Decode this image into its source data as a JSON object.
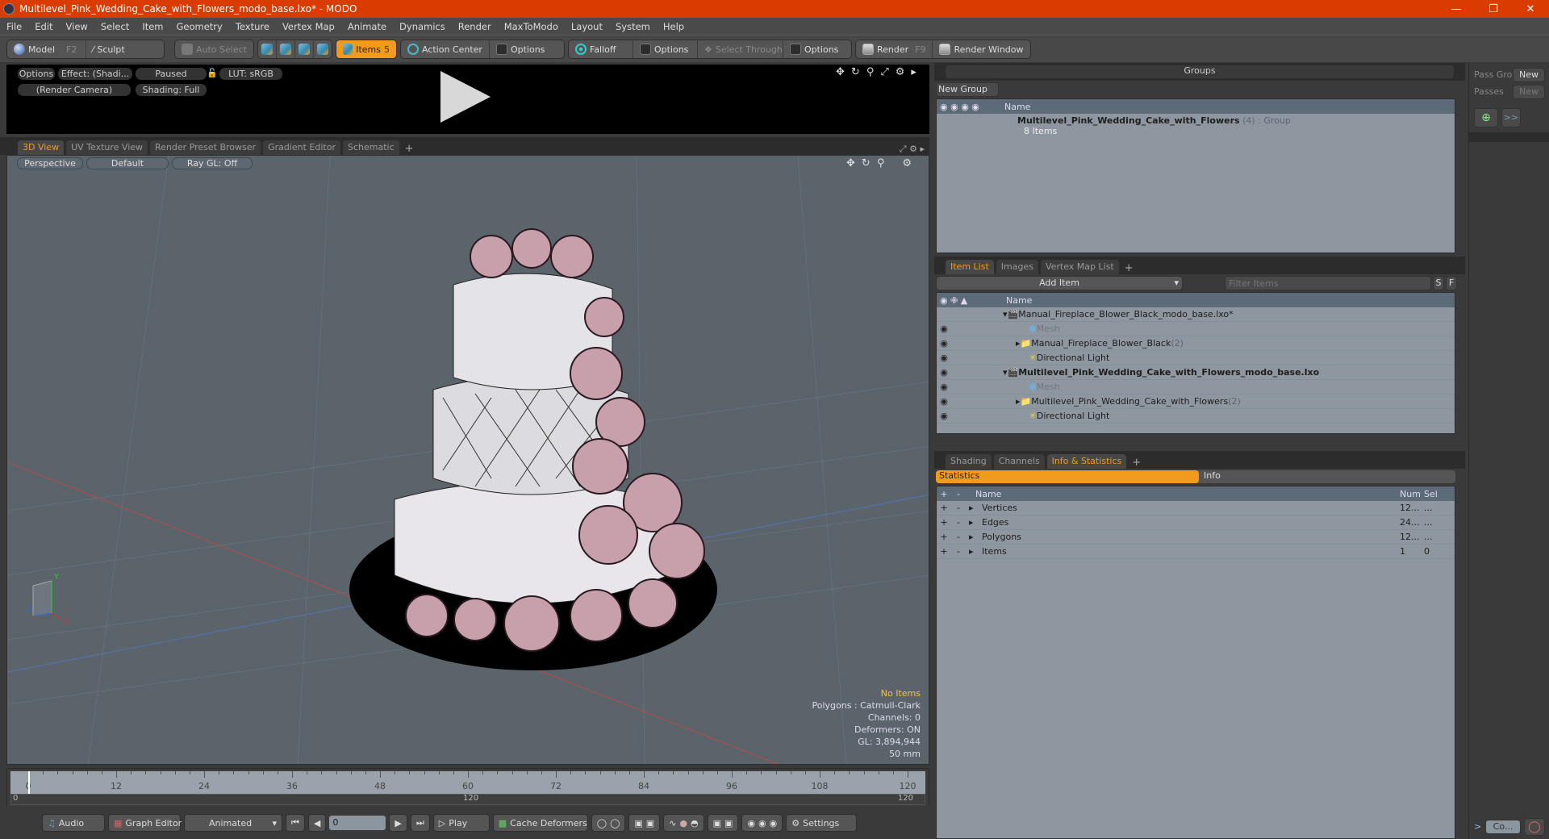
{
  "window": {
    "title": "Multilevel_Pink_Wedding_Cake_with_Flowers_modo_base.lxo* - MODO",
    "controls": [
      "minimize",
      "restore",
      "close"
    ],
    "accent": "#da3b01"
  },
  "menu": [
    "File",
    "Edit",
    "View",
    "Select",
    "Item",
    "Geometry",
    "Texture",
    "Vertex Map",
    "Animate",
    "Dynamics",
    "Render",
    "MaxToModo",
    "Layout",
    "System",
    "Help"
  ],
  "toolbar": {
    "model": "Model",
    "model_key": "F2",
    "sculpt": "Sculpt",
    "auto_select": "Auto Select",
    "items": "Items",
    "items_key": "5",
    "action_center": "Action Center",
    "options1": "Options",
    "falloff": "Falloff",
    "options2": "Options",
    "select_through": "Select Through",
    "options3": "Options",
    "render": "Render",
    "render_key": "F9",
    "render_window": "Render Window",
    "active_color": "#f29a1c"
  },
  "preview": {
    "options": "Options",
    "effect": "Effect: (Shadi...",
    "paused": "Paused",
    "lut": "LUT: sRGB",
    "camera": "(Render Camera)",
    "shading": "Shading: Full"
  },
  "view_tabs": [
    "3D View",
    "UV Texture View",
    "Render Preset Browser",
    "Gradient Editor",
    "Schematic"
  ],
  "viewport": {
    "projection": "Perspective",
    "style": "Default",
    "raygl": "Ray GL: Off",
    "stats": {
      "selection": "No Items",
      "polygons": "Polygons : Catmull-Clark",
      "channels": "Channels: 0",
      "deformers": "Deformers: ON",
      "gl": "GL: 3,894,944",
      "focal": "50 mm"
    },
    "axis_labels": {
      "x": "X",
      "y": "Y",
      "z": "Z"
    }
  },
  "timeline": {
    "ticks": [
      "0",
      "12",
      "24",
      "36",
      "48",
      "60",
      "72",
      "84",
      "96",
      "108",
      "120"
    ],
    "range_start": "0",
    "range_mid": "120",
    "range_end": "120",
    "max_frame": 120
  },
  "transport": {
    "audio": "Audio",
    "graph_editor": "Graph Editor",
    "animated": "Animated",
    "frame": "0",
    "play": "Play",
    "cache_deformers": "Cache Deformers",
    "settings": "Settings"
  },
  "groups": {
    "title": "Groups",
    "new_group": "New Group",
    "col_name": "Name",
    "rows": [
      {
        "name": "Multilevel_Pink_Wedding_Cake_with_Flowers",
        "count": "(4)",
        "type": ": Group",
        "sub": "8 Items"
      }
    ]
  },
  "passes": {
    "pass_groups": "Pass Gro",
    "pass_groups_new": "New",
    "passes": "Passes",
    "passes_new": "New"
  },
  "item_list": {
    "tabs": [
      "Item List",
      "Images",
      "Vertex Map List"
    ],
    "add_item": "Add Item",
    "filter_placeholder": "Filter Items",
    "s_btn": "S",
    "f_btn": "F",
    "col_name": "Name",
    "rows": [
      {
        "name": "Manual_Fireplace_Blower_Black_modo_base.lxo*",
        "type": "scene",
        "indent": 0,
        "bold": false,
        "dim": false
      },
      {
        "name": "Mesh",
        "type": "mesh",
        "indent": 1,
        "dim": true
      },
      {
        "name": "Manual_Fireplace_Blower_Black",
        "count": "(2)",
        "type": "group",
        "indent": 1,
        "dim": false
      },
      {
        "name": "Directional Light",
        "type": "light",
        "indent": 1,
        "dim": false
      },
      {
        "name": "Multilevel_Pink_Wedding_Cake_with_Flowers_modo_base.lxo",
        "type": "scene",
        "indent": 0,
        "bold": true,
        "dim": false
      },
      {
        "name": "Mesh",
        "type": "mesh",
        "indent": 1,
        "dim": true
      },
      {
        "name": "Multilevel_Pink_Wedding_Cake_with_Flowers",
        "count": "(2)",
        "type": "group",
        "indent": 1,
        "dim": false
      },
      {
        "name": "Directional Light",
        "type": "light",
        "indent": 1,
        "dim": false
      }
    ]
  },
  "info_panel": {
    "tabs": [
      "Shading",
      "Channels",
      "Info & Statistics"
    ],
    "subtabs": [
      "Statistics",
      "Info"
    ],
    "cols": {
      "plus": "+",
      "minus": "-",
      "name": "Name",
      "num": "Num",
      "sel": "Sel"
    },
    "rows": [
      {
        "name": "Vertices",
        "num": "12...",
        "sel": "..."
      },
      {
        "name": "Edges",
        "num": "24...",
        "sel": "..."
      },
      {
        "name": "Polygons",
        "num": "12...",
        "sel": "..."
      },
      {
        "name": "Items",
        "num": "1",
        "sel": "0"
      }
    ]
  },
  "command": {
    "prompt": ">",
    "field": "Co..."
  }
}
